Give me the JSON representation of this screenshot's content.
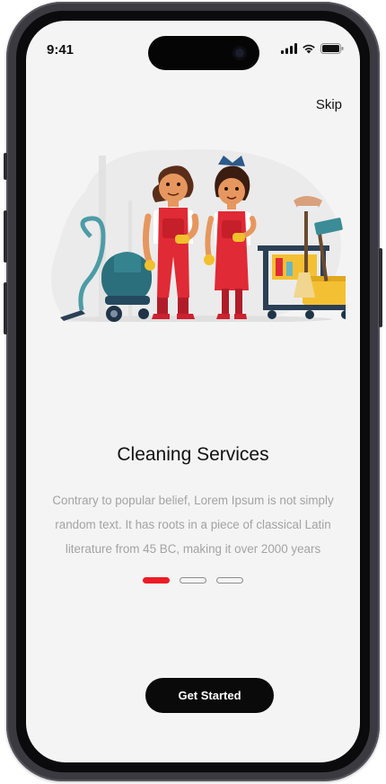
{
  "status_bar": {
    "time": "9:41"
  },
  "header": {
    "skip_label": "Skip"
  },
  "onboarding": {
    "illustration": "cleaning-staff-illustration",
    "title": "Cleaning Services",
    "description": "Contrary to popular belief, Lorem Ipsum is not simply random text. It has roots in a piece of classical Latin literature from 45 BC, making it over 2000 years",
    "page_indicator": {
      "pages": 3,
      "active_index": 0
    },
    "cta_label": "Get Started"
  },
  "colors": {
    "accent": "#ed1c24",
    "button": "#0a0a0a",
    "background": "#f4f4f4",
    "text_muted": "#a3a3a3"
  }
}
